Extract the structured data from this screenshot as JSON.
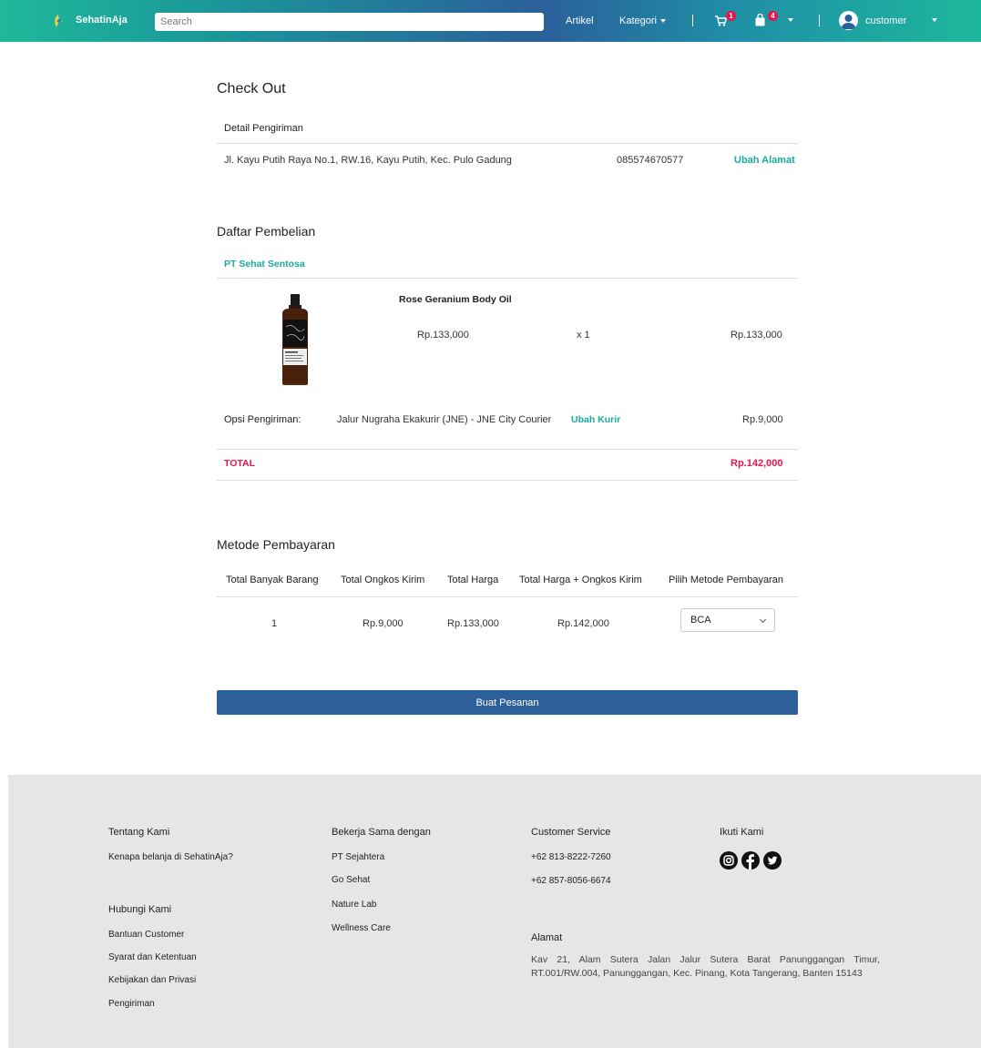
{
  "navbar": {
    "brand": "SehatinAja",
    "search_placeholder": "Search",
    "artikel": "Artikel",
    "kategori": "Kategori",
    "cart_badge": "1",
    "bag_badge": "4",
    "username": "customer",
    "icons": [
      "logo-icon",
      "cart-icon",
      "shopping-bag-icon",
      "user-avatar-icon",
      "caret-down-icon"
    ]
  },
  "checkout": {
    "title": "Check Out",
    "shipping_detail": {
      "heading": "Detail Pengiriman",
      "address": "Jl. Kayu Putih Raya No.1, RW.16, Kayu Putih, Kec. Pulo Gadung",
      "phone": "085574670577",
      "change_label": "Ubah Alamat"
    },
    "purchase_list": {
      "heading": "Daftar Pembelian",
      "seller": "PT Sehat Sentosa",
      "items": [
        {
          "name": "Rose Geranium Body Oil",
          "price": "Rp.133,000",
          "qty": "x 1",
          "subtotal": "Rp.133,000"
        }
      ],
      "shipping_option": {
        "label": "Opsi Pengiriman:",
        "value": "Jalur Nugraha Ekakurir (JNE) - JNE City Courier",
        "change_label": "Ubah Kurir",
        "cost": "Rp.9,000"
      },
      "total_label": "TOTAL",
      "total_value": "Rp.142,000"
    },
    "payment": {
      "heading": "Metode Pembayaran",
      "columns": [
        "Total Banyak Barang",
        "Total Ongkos Kirim",
        "Total Harga",
        "Total Harga + Ongkos Kirim",
        "Pilih Metode Pembayaran"
      ],
      "row": [
        "1",
        "Rp.9,000",
        "Rp.133,000",
        "Rp.142,000"
      ],
      "selected_method": "BCA"
    },
    "submit_label": "Buat Pesanan"
  },
  "footer": {
    "about_heading": "Tentang Kami",
    "about_link": "Kenapa belanja di SehatinAja?",
    "contact_heading": "Hubungi Kami",
    "contact_links": [
      "Bantuan Customer",
      "Syarat dan Ketentuan",
      "Kebijakan dan Privasi",
      "Pengiriman"
    ],
    "partners_heading": "Bekerja Sama dengan",
    "partners": [
      "PT Sejahtera",
      "Go Sehat",
      "Nature Lab",
      "Wellness Care"
    ],
    "cs_heading": "Customer Service",
    "cs_phones": [
      "+62 813-8222-7260",
      "+62 857-8056-6674"
    ],
    "address_heading": "Alamat",
    "address": "Kav 21, Alam Sutera Jalan Jalur Sutera Barat Panunggangan Timur, RT.001/RW.004, Panunggangan, Kec. Pinang, Kota Tangerang, Banten 15143",
    "social_heading": "Ikuti Kami",
    "social_icons": [
      "instagram-icon",
      "facebook-icon",
      "twitter-icon"
    ]
  },
  "colors": {
    "accent": "#1aab9b",
    "total": "#e8134d",
    "button": "#2d5f98",
    "footer_bg": "#e6e6e6"
  }
}
